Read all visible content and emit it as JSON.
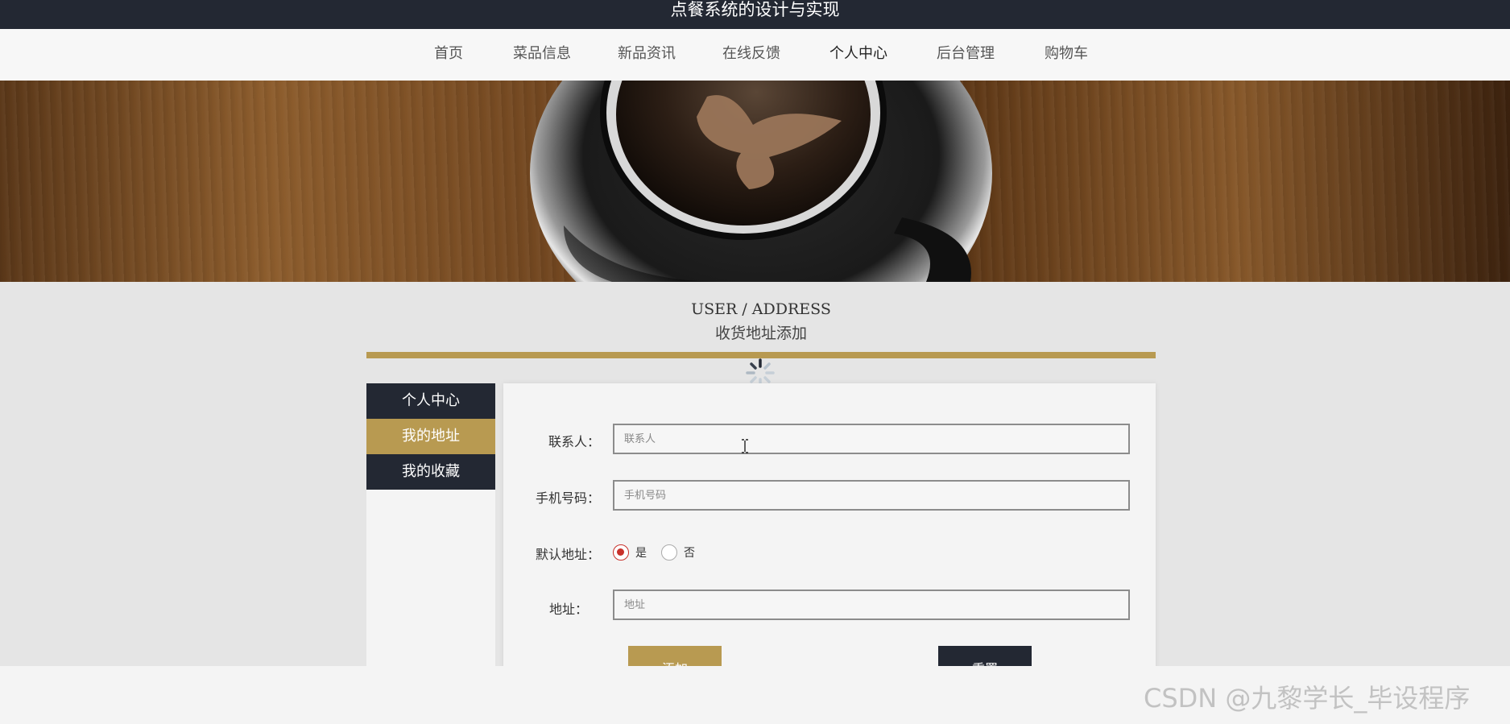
{
  "topbar": {
    "title": "点餐系统的设计与实现"
  },
  "nav": {
    "items": [
      {
        "label": "首页",
        "active": false
      },
      {
        "label": "菜品信息",
        "active": false
      },
      {
        "label": "新品资讯",
        "active": false
      },
      {
        "label": "在线反馈",
        "active": false
      },
      {
        "label": "个人中心",
        "active": true
      },
      {
        "label": "后台管理",
        "active": false
      },
      {
        "label": "购物车",
        "active": false
      }
    ]
  },
  "section": {
    "title_en": "USER / ADDRESS",
    "title_zh": "收货地址添加"
  },
  "sidebar": {
    "items": [
      {
        "label": "个人中心",
        "active": false
      },
      {
        "label": "我的地址",
        "active": true
      },
      {
        "label": "我的收藏",
        "active": false
      }
    ]
  },
  "form": {
    "contact": {
      "label": "联系人：",
      "placeholder": "联系人",
      "value": ""
    },
    "phone": {
      "label": "手机号码：",
      "placeholder": "手机号码",
      "value": ""
    },
    "default_address": {
      "label": "默认地址：",
      "options": [
        {
          "label": "是",
          "checked": true
        },
        {
          "label": "否",
          "checked": false
        }
      ]
    },
    "address": {
      "label": "地址：",
      "placeholder": "地址",
      "value": ""
    },
    "add_button": "添加",
    "reset_button": "重置"
  },
  "watermark": "CSDN @九黎学长_毕设程序",
  "colors": {
    "gold": "#b89a51",
    "dark": "#232833",
    "radio_checked": "#c8312b"
  },
  "icons": {
    "loading": "loading-spinner-icon",
    "cursor": "text-cursor-icon"
  }
}
